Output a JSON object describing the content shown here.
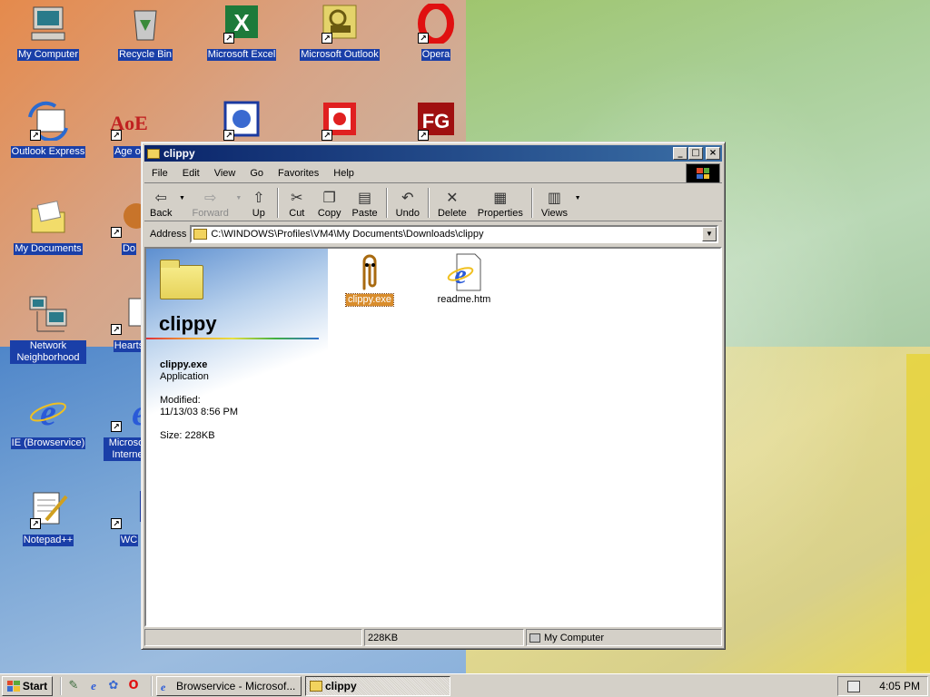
{
  "desktop": {
    "icons": [
      {
        "label": "My Computer",
        "glyph": "computer-icon"
      },
      {
        "label": "Recycle Bin",
        "glyph": "recycle-bin-icon"
      },
      {
        "label": "Microsoft Excel",
        "glyph": "excel-icon"
      },
      {
        "label": "Microsoft Outlook",
        "glyph": "outlook-icon"
      },
      {
        "label": "Opera",
        "glyph": "opera-icon"
      },
      {
        "label": "Outlook Express",
        "glyph": "outlook-express-icon"
      },
      {
        "label": "Age of",
        "glyph": "age-of-empires-icon"
      },
      {
        "label": "",
        "glyph": "blue-app-icon"
      },
      {
        "label": "",
        "glyph": "red-app-icon"
      },
      {
        "label": "",
        "glyph": "fg-icon"
      },
      {
        "label": "My Documents",
        "glyph": "my-documents-icon"
      },
      {
        "label": "Do",
        "glyph": "doc-icon"
      },
      {
        "label": "Network Neighborhood",
        "glyph": "network-icon"
      },
      {
        "label": "Hearts",
        "glyph": "hearts-icon"
      },
      {
        "label": "IE (Browservice)",
        "glyph": "ie-icon"
      },
      {
        "label": "Microsoft Internet",
        "glyph": "ie-icon"
      },
      {
        "label": "Notepad++",
        "glyph": "notepad-icon"
      },
      {
        "label": "WC",
        "glyph": "wc-icon"
      }
    ]
  },
  "window": {
    "title": "clippy",
    "buttons": {
      "minimize": "_",
      "maximize": "□",
      "close": "×"
    },
    "menu": [
      "File",
      "Edit",
      "View",
      "Go",
      "Favorites",
      "Help"
    ],
    "toolbar": {
      "back": "Back",
      "forward": "Forward",
      "up": "Up",
      "cut": "Cut",
      "copy": "Copy",
      "paste": "Paste",
      "undo": "Undo",
      "delete": "Delete",
      "properties": "Properties",
      "views": "Views"
    },
    "address": {
      "label": "Address",
      "value": "C:\\WINDOWS\\Profiles\\VM4\\My Documents\\Downloads\\clippy"
    },
    "webview": {
      "folder_title": "clippy",
      "selected_name": "clippy.exe",
      "selected_type": "Application",
      "modified_label": "Modified:",
      "modified_value": "11/13/03 8:56 PM",
      "size_text": "Size: 228KB"
    },
    "files": [
      {
        "name": "clippy.exe",
        "selected": true
      },
      {
        "name": "readme.htm",
        "selected": false
      }
    ],
    "status": {
      "size": "228KB",
      "zone": "My Computer"
    }
  },
  "taskbar": {
    "start": "Start",
    "tasks": [
      {
        "label": "Browservice - Microsof...",
        "active": false
      },
      {
        "label": "clippy",
        "active": true
      }
    ],
    "clock": "4:05 PM"
  },
  "colors": {
    "title_active": "#0a246a",
    "selection": "#d98d2c",
    "face": "#d4d0c8"
  }
}
